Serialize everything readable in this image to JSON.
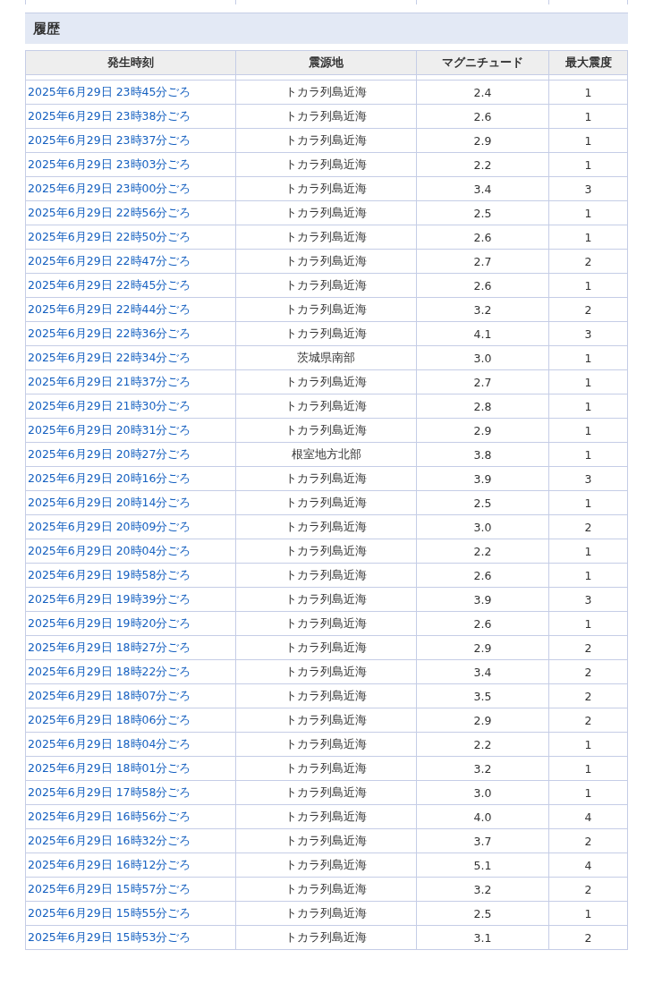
{
  "section_title": "履歴",
  "table": {
    "columns": [
      "発生時刻",
      "震源地",
      "マグニチュード",
      "最大震度"
    ],
    "rows": [
      [
        "2025年6月29日 23時45分ごろ",
        "トカラ列島近海",
        "2.4",
        "1"
      ],
      [
        "2025年6月29日 23時38分ごろ",
        "トカラ列島近海",
        "2.6",
        "1"
      ],
      [
        "2025年6月29日 23時37分ごろ",
        "トカラ列島近海",
        "2.9",
        "1"
      ],
      [
        "2025年6月29日 23時03分ごろ",
        "トカラ列島近海",
        "2.2",
        "1"
      ],
      [
        "2025年6月29日 23時00分ごろ",
        "トカラ列島近海",
        "3.4",
        "3"
      ],
      [
        "2025年6月29日 22時56分ごろ",
        "トカラ列島近海",
        "2.5",
        "1"
      ],
      [
        "2025年6月29日 22時50分ごろ",
        "トカラ列島近海",
        "2.6",
        "1"
      ],
      [
        "2025年6月29日 22時47分ごろ",
        "トカラ列島近海",
        "2.7",
        "2"
      ],
      [
        "2025年6月29日 22時45分ごろ",
        "トカラ列島近海",
        "2.6",
        "1"
      ],
      [
        "2025年6月29日 22時44分ごろ",
        "トカラ列島近海",
        "3.2",
        "2"
      ],
      [
        "2025年6月29日 22時36分ごろ",
        "トカラ列島近海",
        "4.1",
        "3"
      ],
      [
        "2025年6月29日 22時34分ごろ",
        "茨城県南部",
        "3.0",
        "1"
      ],
      [
        "2025年6月29日 21時37分ごろ",
        "トカラ列島近海",
        "2.7",
        "1"
      ],
      [
        "2025年6月29日 21時30分ごろ",
        "トカラ列島近海",
        "2.8",
        "1"
      ],
      [
        "2025年6月29日 20時31分ごろ",
        "トカラ列島近海",
        "2.9",
        "1"
      ],
      [
        "2025年6月29日 20時27分ごろ",
        "根室地方北部",
        "3.8",
        "1"
      ],
      [
        "2025年6月29日 20時16分ごろ",
        "トカラ列島近海",
        "3.9",
        "3"
      ],
      [
        "2025年6月29日 20時14分ごろ",
        "トカラ列島近海",
        "2.5",
        "1"
      ],
      [
        "2025年6月29日 20時09分ごろ",
        "トカラ列島近海",
        "3.0",
        "2"
      ],
      [
        "2025年6月29日 20時04分ごろ",
        "トカラ列島近海",
        "2.2",
        "1"
      ],
      [
        "2025年6月29日 19時58分ごろ",
        "トカラ列島近海",
        "2.6",
        "1"
      ],
      [
        "2025年6月29日 19時39分ごろ",
        "トカラ列島近海",
        "3.9",
        "3"
      ],
      [
        "2025年6月29日 19時20分ごろ",
        "トカラ列島近海",
        "2.6",
        "1"
      ],
      [
        "2025年6月29日 18時27分ごろ",
        "トカラ列島近海",
        "2.9",
        "2"
      ],
      [
        "2025年6月29日 18時22分ごろ",
        "トカラ列島近海",
        "3.4",
        "2"
      ],
      [
        "2025年6月29日 18時07分ごろ",
        "トカラ列島近海",
        "3.5",
        "2"
      ],
      [
        "2025年6月29日 18時06分ごろ",
        "トカラ列島近海",
        "2.9",
        "2"
      ],
      [
        "2025年6月29日 18時04分ごろ",
        "トカラ列島近海",
        "2.2",
        "1"
      ],
      [
        "2025年6月29日 18時01分ごろ",
        "トカラ列島近海",
        "3.2",
        "1"
      ],
      [
        "2025年6月29日 17時58分ごろ",
        "トカラ列島近海",
        "3.0",
        "1"
      ],
      [
        "2025年6月29日 16時56分ごろ",
        "トカラ列島近海",
        "4.0",
        "4"
      ],
      [
        "2025年6月29日 16時32分ごろ",
        "トカラ列島近海",
        "3.7",
        "2"
      ],
      [
        "2025年6月29日 16時12分ごろ",
        "トカラ列島近海",
        "5.1",
        "4"
      ],
      [
        "2025年6月29日 15時57分ごろ",
        "トカラ列島近海",
        "3.2",
        "2"
      ],
      [
        "2025年6月29日 15時55分ごろ",
        "トカラ列島近海",
        "2.5",
        "1"
      ],
      [
        "2025年6月29日 15時53分ごろ",
        "トカラ列島近海",
        "3.1",
        "2"
      ]
    ]
  }
}
